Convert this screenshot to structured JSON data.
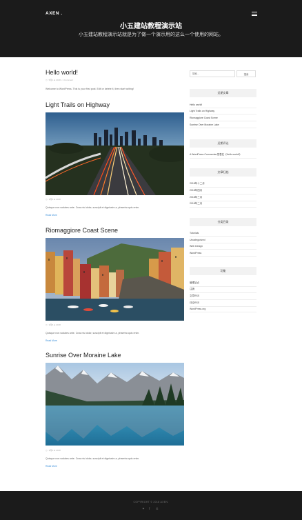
{
  "header": {
    "logo": "AXEN .",
    "title": "小五建站教程演示站",
    "description": "小五建站教程演示站就是为了做一个演示用的这么一个使用的网站。"
  },
  "posts": [
    {
      "title": "Hello world!",
      "meta": "5月2 at 2018   •   1 Comment",
      "excerpt": "Welcome to WordPress. This is your first post. Edit or delete it, then start writing!"
    },
    {
      "title": "Light Trails on Highway",
      "meta": "3月8 at 2018",
      "excerpt": "Quisque non sodales ante. Cras nisi dolor, suscipit et dignissim a, pharetra quis enim.",
      "read_more": "Read More"
    },
    {
      "title": "Riomaggiore Coast Scene",
      "meta": "3月8 at 2018",
      "excerpt": "Quisque non sodales ante. Cras nisi dolor, suscipit et dignissim a, pharetra quis enim.",
      "read_more": "Read More"
    },
    {
      "title": "Sunrise Over Moraine Lake",
      "meta": "3月8 at 2018",
      "excerpt": "Quisque non sodales ante. Cras nisi dolor, suscipit et dignissim a, pharetra quis enim.",
      "read_more": "Read More"
    }
  ],
  "sidebar": {
    "search_placeholder": "搜索…",
    "search_button": "搜索",
    "recent_posts": {
      "title": "近期文章",
      "items": [
        "Hello world!",
        "Light Trails on Highway",
        "Riomaggiore Coast Scene",
        "Sunrise Over Moraine Lake"
      ]
    },
    "recent_comments": {
      "title": "近期评论",
      "items": [
        "A WordPress Commenter发表在《Hello world!》"
      ]
    },
    "archives": {
      "title": "文章归档",
      "items": [
        "2018年十二月",
        "2018年四月",
        "2018年三月",
        "2018年二月"
      ]
    },
    "categories": {
      "title": "分类目录",
      "items": [
        "Tutorials",
        "Uncategorized",
        "Web Design",
        "WordPress"
      ]
    },
    "meta": {
      "title": "功能",
      "items": [
        "管理站点",
        "注销",
        "文章RSS",
        "评论RSS",
        "WordPress.org"
      ]
    }
  },
  "footer": {
    "copyright": "COPYRIGHT © 2018 AXEN.",
    "social": [
      "twitter-icon",
      "facebook-icon",
      "google-plus-icon"
    ]
  }
}
